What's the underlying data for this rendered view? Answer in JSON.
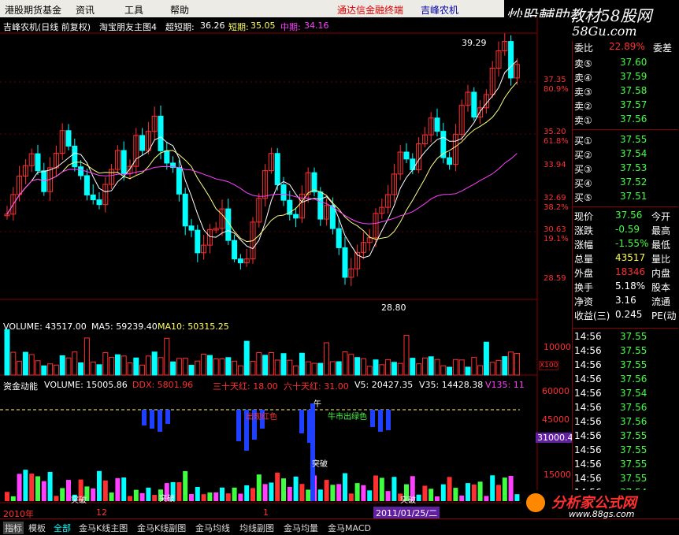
{
  "menu": {
    "items": [
      "港股期货基金",
      "资讯",
      "工具",
      "帮助"
    ],
    "ad": "通达信金融终端",
    "stock": "吉峰农机"
  },
  "brand": {
    "title": "炒股輔助教材58股网",
    "url": "www.58Gu.com"
  },
  "price_header": {
    "name": "吉峰农机(日线 前复权)",
    "indicator": "淘宝朋友主图4",
    "ultra_short_label": "超短期:",
    "ultra_short": "36.26",
    "short_label": "短期:",
    "short": "35.05",
    "mid_label": "中期:",
    "mid": "34.16"
  },
  "price_axis": [
    {
      "v": "37.35",
      "p": "80.9%"
    },
    {
      "v": "35.20",
      "p": "61.8%"
    },
    {
      "v": "33.94",
      "p": ""
    },
    {
      "v": "32.69",
      "p": "38.2%"
    },
    {
      "v": "30.63",
      "p": "19.1%"
    },
    {
      "v": "28.59",
      "p": ""
    }
  ],
  "price_marks": {
    "high": "39.29",
    "low": "28.80"
  },
  "volume_header": {
    "title": "VOLUME: 43517.00",
    "ma5": "MA5: 59239.40",
    "ma10": "MA10: 50315.25"
  },
  "volume_axis": [
    "10000",
    "X100"
  ],
  "fund_header": {
    "title": "资金动能",
    "vol": "VOLUME: 15005.86",
    "ddx": "DDX: 5801.96",
    "t30": "三十天红: 18.00",
    "t60": "六十天红: 31.00",
    "v5": "V5: 20427.35",
    "v35": "V35: 14428.38",
    "v135": "V135: 11"
  },
  "fund_axis": [
    "60000",
    "45000",
    "31000.4",
    "15000"
  ],
  "fund_labels": {
    "wu": "午",
    "tupo": "突破",
    "green_text": "牛市出绿色",
    "red_text": "出现红色",
    "tupo2": "突破",
    "tupo3": "突破",
    "tupo4": "突破"
  },
  "date_axis": {
    "left": "2010年",
    "mid": "12",
    "m1": "1",
    "date_box": "2011/01/25/二"
  },
  "order_book": {
    "ratio_label": "委比",
    "ratio": "22.89%",
    "diff_label": "委差",
    "sell": [
      {
        "l": "卖⑤",
        "p": "37.60"
      },
      {
        "l": "卖④",
        "p": "37.59"
      },
      {
        "l": "卖③",
        "p": "37.58"
      },
      {
        "l": "卖②",
        "p": "37.57"
      },
      {
        "l": "卖①",
        "p": "37.56"
      }
    ],
    "buy": [
      {
        "l": "买①",
        "p": "37.55"
      },
      {
        "l": "买②",
        "p": "37.54"
      },
      {
        "l": "买③",
        "p": "37.53"
      },
      {
        "l": "买④",
        "p": "37.52"
      },
      {
        "l": "买⑤",
        "p": "37.51"
      }
    ]
  },
  "quote": [
    {
      "l": "现价",
      "v": "37.56",
      "r": "今开"
    },
    {
      "l": "涨跌",
      "v": "-0.59",
      "r": "最高"
    },
    {
      "l": "涨幅",
      "v": "-1.55%",
      "r": "最低"
    },
    {
      "l": "总量",
      "v": "43517",
      "r": "量比"
    },
    {
      "l": "外盘",
      "v": "18346",
      "r": "内盘"
    },
    {
      "l": "换手",
      "v": "5.18%",
      "r": "股本"
    },
    {
      "l": "净资",
      "v": "3.16",
      "r": "流通"
    },
    {
      "l": "收益(三)",
      "v": "0.245",
      "r": "PE(动"
    }
  ],
  "ticks": [
    {
      "t": "14:56",
      "p": "37.55"
    },
    {
      "t": "14:56",
      "p": "37.55"
    },
    {
      "t": "14:56",
      "p": "37.55"
    },
    {
      "t": "14:56",
      "p": "37.56"
    },
    {
      "t": "14:56",
      "p": "37.54"
    },
    {
      "t": "14:56",
      "p": "37.56"
    },
    {
      "t": "14:56",
      "p": "37.56"
    },
    {
      "t": "14:56",
      "p": "37.55"
    },
    {
      "t": "14:56",
      "p": "37.55"
    },
    {
      "t": "14:56",
      "p": "37.55"
    },
    {
      "t": "14:56",
      "p": "37.55"
    },
    {
      "t": "14:56",
      "p": "37.54"
    },
    {
      "t": "14:56",
      "p": "37.54"
    }
  ],
  "bottom_tabs": [
    "指标",
    "模板",
    "全部",
    "金马K线主图",
    "金马K线副图",
    "金马均线",
    "均线副图",
    "金马均量",
    "金马MACD"
  ],
  "watermark": {
    "text": "分析家公式网",
    "url": "www.88gs.com"
  },
  "colors": {
    "up": "#ff3030",
    "down": "#00ffff",
    "ma1": "#ffffff",
    "ma2": "#ffff80",
    "ma3": "#ff40ff"
  }
}
